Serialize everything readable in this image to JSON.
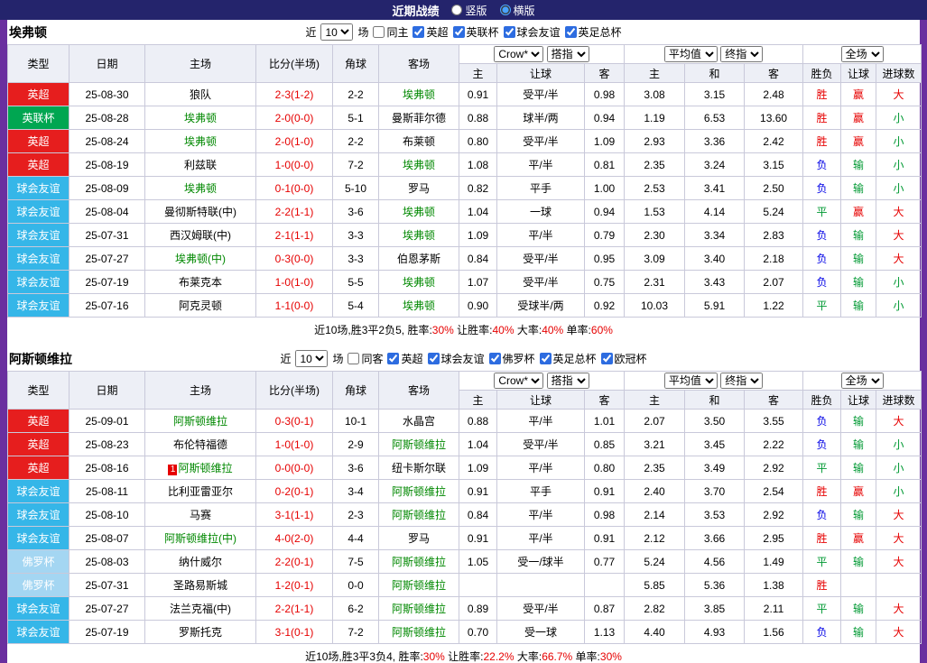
{
  "topbar": {
    "title": "近期战绩",
    "radios": [
      {
        "label": "竖版",
        "selected": false
      },
      {
        "label": "横版",
        "selected": true
      }
    ]
  },
  "columns": {
    "type": "类型",
    "date": "日期",
    "home": "主场",
    "score": "比分(半场)",
    "corner": "角球",
    "away": "客场",
    "odds_sel_a": "Crow*",
    "odds_sel_b": "搭指",
    "o1_home": "主",
    "o1_handicap": "让球",
    "o1_away": "客",
    "avg_sel_a": "平均值",
    "avg_sel_b": "终指",
    "o2_home": "主",
    "o2_draw": "和",
    "o2_away": "客",
    "full_sel": "全场",
    "r_result": "胜负",
    "r_handicap": "让球",
    "r_goals": "进球数"
  },
  "type_colors": {
    "英超": "#e61e1e",
    "英联杯": "#00a651",
    "球会友谊": "#35b6e8",
    "佛罗杯": "#a4d6f2"
  },
  "result_colors": {
    "red": "#e60000",
    "green": "#009933",
    "blue": "#0000e6"
  },
  "tables": [
    {
      "team": "埃弗顿",
      "filter": {
        "near": "近",
        "count": "10",
        "games": "场",
        "checks": [
          {
            "label": "同主",
            "checked": false
          },
          {
            "label": "英超",
            "checked": true
          },
          {
            "label": "英联杯",
            "checked": true
          },
          {
            "label": "球会友谊",
            "checked": true
          },
          {
            "label": "英足总杯",
            "checked": true
          }
        ]
      },
      "rows": [
        {
          "type": "英超",
          "date": "25-08-30",
          "home": {
            "name": "狼队",
            "hl": false
          },
          "score": "2-3(1-2)",
          "corner": "2-2",
          "away": {
            "name": "埃弗顿",
            "hl": true
          },
          "o1": [
            "0.91",
            "受平/半",
            "0.98"
          ],
          "o2": [
            "3.08",
            "3.15",
            "2.48"
          ],
          "res": {
            "t": "胜",
            "c": "red"
          },
          "let": {
            "t": "赢",
            "c": "red"
          },
          "goal": {
            "t": "大",
            "c": "red"
          }
        },
        {
          "type": "英联杯",
          "date": "25-08-28",
          "home": {
            "name": "埃弗顿",
            "hl": true
          },
          "score": "2-0(0-0)",
          "corner": "5-1",
          "away": {
            "name": "曼斯菲尔德",
            "hl": false
          },
          "o1": [
            "0.88",
            "球半/两",
            "0.94"
          ],
          "o2": [
            "1.19",
            "6.53",
            "13.60"
          ],
          "res": {
            "t": "胜",
            "c": "red"
          },
          "let": {
            "t": "赢",
            "c": "red"
          },
          "goal": {
            "t": "小",
            "c": "green"
          }
        },
        {
          "type": "英超",
          "date": "25-08-24",
          "home": {
            "name": "埃弗顿",
            "hl": true
          },
          "score": "2-0(1-0)",
          "corner": "2-2",
          "away": {
            "name": "布莱顿",
            "hl": false
          },
          "o1": [
            "0.80",
            "受平/半",
            "1.09"
          ],
          "o2": [
            "2.93",
            "3.36",
            "2.42"
          ],
          "res": {
            "t": "胜",
            "c": "red"
          },
          "let": {
            "t": "赢",
            "c": "red"
          },
          "goal": {
            "t": "小",
            "c": "green"
          }
        },
        {
          "type": "英超",
          "date": "25-08-19",
          "home": {
            "name": "利兹联",
            "hl": false
          },
          "score": "1-0(0-0)",
          "corner": "7-2",
          "away": {
            "name": "埃弗顿",
            "hl": true
          },
          "o1": [
            "1.08",
            "平/半",
            "0.81"
          ],
          "o2": [
            "2.35",
            "3.24",
            "3.15"
          ],
          "res": {
            "t": "负",
            "c": "blue"
          },
          "let": {
            "t": "输",
            "c": "green"
          },
          "goal": {
            "t": "小",
            "c": "green"
          }
        },
        {
          "type": "球会友谊",
          "date": "25-08-09",
          "home": {
            "name": "埃弗顿",
            "hl": true
          },
          "score": "0-1(0-0)",
          "corner": "5-10",
          "away": {
            "name": "罗马",
            "hl": false
          },
          "o1": [
            "0.82",
            "平手",
            "1.00"
          ],
          "o2": [
            "2.53",
            "3.41",
            "2.50"
          ],
          "res": {
            "t": "负",
            "c": "blue"
          },
          "let": {
            "t": "输",
            "c": "green"
          },
          "goal": {
            "t": "小",
            "c": "green"
          }
        },
        {
          "type": "球会友谊",
          "date": "25-08-04",
          "home": {
            "name": "曼彻斯特联(中)",
            "hl": false
          },
          "score": "2-2(1-1)",
          "corner": "3-6",
          "away": {
            "name": "埃弗顿",
            "hl": true
          },
          "o1": [
            "1.04",
            "一球",
            "0.94"
          ],
          "o2": [
            "1.53",
            "4.14",
            "5.24"
          ],
          "res": {
            "t": "平",
            "c": "green"
          },
          "let": {
            "t": "赢",
            "c": "red"
          },
          "goal": {
            "t": "大",
            "c": "red"
          }
        },
        {
          "type": "球会友谊",
          "date": "25-07-31",
          "home": {
            "name": "西汉姆联(中)",
            "hl": false
          },
          "score": "2-1(1-1)",
          "corner": "3-3",
          "away": {
            "name": "埃弗顿",
            "hl": true
          },
          "o1": [
            "1.09",
            "平/半",
            "0.79"
          ],
          "o2": [
            "2.30",
            "3.34",
            "2.83"
          ],
          "res": {
            "t": "负",
            "c": "blue"
          },
          "let": {
            "t": "输",
            "c": "green"
          },
          "goal": {
            "t": "大",
            "c": "red"
          }
        },
        {
          "type": "球会友谊",
          "date": "25-07-27",
          "home": {
            "name": "埃弗顿(中)",
            "hl": true
          },
          "score": "0-3(0-0)",
          "corner": "3-3",
          "away": {
            "name": "伯恩茅斯",
            "hl": false
          },
          "o1": [
            "0.84",
            "受平/半",
            "0.95"
          ],
          "o2": [
            "3.09",
            "3.40",
            "2.18"
          ],
          "res": {
            "t": "负",
            "c": "blue"
          },
          "let": {
            "t": "输",
            "c": "green"
          },
          "goal": {
            "t": "大",
            "c": "red"
          }
        },
        {
          "type": "球会友谊",
          "date": "25-07-19",
          "home": {
            "name": "布莱克本",
            "hl": false
          },
          "score": "1-0(1-0)",
          "corner": "5-5",
          "away": {
            "name": "埃弗顿",
            "hl": true
          },
          "o1": [
            "1.07",
            "受平/半",
            "0.75"
          ],
          "o2": [
            "2.31",
            "3.43",
            "2.07"
          ],
          "res": {
            "t": "负",
            "c": "blue"
          },
          "let": {
            "t": "输",
            "c": "green"
          },
          "goal": {
            "t": "小",
            "c": "green"
          }
        },
        {
          "type": "球会友谊",
          "date": "25-07-16",
          "home": {
            "name": "阿克灵顿",
            "hl": false
          },
          "score": "1-1(0-0)",
          "corner": "5-4",
          "away": {
            "name": "埃弗顿",
            "hl": true
          },
          "o1": [
            "0.90",
            "受球半/两",
            "0.92"
          ],
          "o2": [
            "10.03",
            "5.91",
            "1.22"
          ],
          "res": {
            "t": "平",
            "c": "green"
          },
          "let": {
            "t": "输",
            "c": "green"
          },
          "goal": {
            "t": "小",
            "c": "green"
          }
        }
      ],
      "summary": {
        "prefix": "近10场,胜3平2负5, ",
        "items": [
          {
            "label": "胜率:",
            "value": "30%"
          },
          {
            "label": "让胜率:",
            "value": "40%"
          },
          {
            "label": "大率:",
            "value": "40%"
          },
          {
            "label": "单率:",
            "value": "60%"
          }
        ]
      }
    },
    {
      "team": "阿斯顿维拉",
      "filter": {
        "near": "近",
        "count": "10",
        "games": "场",
        "checks": [
          {
            "label": "同客",
            "checked": false
          },
          {
            "label": "英超",
            "checked": true
          },
          {
            "label": "球会友谊",
            "checked": true
          },
          {
            "label": "佛罗杯",
            "checked": true
          },
          {
            "label": "英足总杯",
            "checked": true
          },
          {
            "label": "欧冠杯",
            "checked": true
          }
        ]
      },
      "rows": [
        {
          "type": "英超",
          "date": "25-09-01",
          "home": {
            "name": "阿斯顿维拉",
            "hl": true
          },
          "score": "0-3(0-1)",
          "corner": "10-1",
          "away": {
            "name": "水晶宫",
            "hl": false
          },
          "o1": [
            "0.88",
            "平/半",
            "1.01"
          ],
          "o2": [
            "2.07",
            "3.50",
            "3.55"
          ],
          "res": {
            "t": "负",
            "c": "blue"
          },
          "let": {
            "t": "输",
            "c": "green"
          },
          "goal": {
            "t": "大",
            "c": "red"
          }
        },
        {
          "type": "英超",
          "date": "25-08-23",
          "home": {
            "name": "布伦特福德",
            "hl": false
          },
          "score": "1-0(1-0)",
          "corner": "2-9",
          "away": {
            "name": "阿斯顿维拉",
            "hl": true
          },
          "o1": [
            "1.04",
            "受平/半",
            "0.85"
          ],
          "o2": [
            "3.21",
            "3.45",
            "2.22"
          ],
          "res": {
            "t": "负",
            "c": "blue"
          },
          "let": {
            "t": "输",
            "c": "green"
          },
          "goal": {
            "t": "小",
            "c": "green"
          }
        },
        {
          "type": "英超",
          "date": "25-08-16",
          "home": {
            "name": "阿斯顿维拉",
            "hl": true,
            "badge": "1"
          },
          "score": "0-0(0-0)",
          "corner": "3-6",
          "away": {
            "name": "纽卡斯尔联",
            "hl": false
          },
          "o1": [
            "1.09",
            "平/半",
            "0.80"
          ],
          "o2": [
            "2.35",
            "3.49",
            "2.92"
          ],
          "res": {
            "t": "平",
            "c": "green"
          },
          "let": {
            "t": "输",
            "c": "green"
          },
          "goal": {
            "t": "小",
            "c": "green"
          }
        },
        {
          "type": "球会友谊",
          "date": "25-08-11",
          "home": {
            "name": "比利亚雷亚尔",
            "hl": false
          },
          "score": "0-2(0-1)",
          "corner": "3-4",
          "away": {
            "name": "阿斯顿维拉",
            "hl": true
          },
          "o1": [
            "0.91",
            "平手",
            "0.91"
          ],
          "o2": [
            "2.40",
            "3.70",
            "2.54"
          ],
          "res": {
            "t": "胜",
            "c": "red"
          },
          "let": {
            "t": "赢",
            "c": "red"
          },
          "goal": {
            "t": "小",
            "c": "green"
          }
        },
        {
          "type": "球会友谊",
          "date": "25-08-10",
          "home": {
            "name": "马赛",
            "hl": false
          },
          "score": "3-1(1-1)",
          "corner": "2-3",
          "away": {
            "name": "阿斯顿维拉",
            "hl": true
          },
          "o1": [
            "0.84",
            "平/半",
            "0.98"
          ],
          "o2": [
            "2.14",
            "3.53",
            "2.92"
          ],
          "res": {
            "t": "负",
            "c": "blue"
          },
          "let": {
            "t": "输",
            "c": "green"
          },
          "goal": {
            "t": "大",
            "c": "red"
          }
        },
        {
          "type": "球会友谊",
          "date": "25-08-07",
          "home": {
            "name": "阿斯顿维拉(中)",
            "hl": true
          },
          "score": "4-0(2-0)",
          "corner": "4-4",
          "away": {
            "name": "罗马",
            "hl": false
          },
          "o1": [
            "0.91",
            "平/半",
            "0.91"
          ],
          "o2": [
            "2.12",
            "3.66",
            "2.95"
          ],
          "res": {
            "t": "胜",
            "c": "red"
          },
          "let": {
            "t": "赢",
            "c": "red"
          },
          "goal": {
            "t": "大",
            "c": "red"
          }
        },
        {
          "type": "佛罗杯",
          "date": "25-08-03",
          "home": {
            "name": "纳什威尔",
            "hl": false
          },
          "score": "2-2(0-1)",
          "corner": "7-5",
          "away": {
            "name": "阿斯顿维拉",
            "hl": true
          },
          "o1": [
            "1.05",
            "受一/球半",
            "0.77"
          ],
          "o2": [
            "5.24",
            "4.56",
            "1.49"
          ],
          "res": {
            "t": "平",
            "c": "green"
          },
          "let": {
            "t": "输",
            "c": "green"
          },
          "goal": {
            "t": "大",
            "c": "red"
          }
        },
        {
          "type": "佛罗杯",
          "date": "25-07-31",
          "home": {
            "name": "圣路易斯城",
            "hl": false
          },
          "score": "1-2(0-1)",
          "corner": "0-0",
          "away": {
            "name": "阿斯顿维拉",
            "hl": true
          },
          "o1": [
            "",
            "",
            ""
          ],
          "o2": [
            "5.85",
            "5.36",
            "1.38"
          ],
          "res": {
            "t": "胜",
            "c": "red"
          },
          "let": {
            "t": "",
            "c": ""
          },
          "goal": {
            "t": "",
            "c": ""
          }
        },
        {
          "type": "球会友谊",
          "date": "25-07-27",
          "home": {
            "name": "法兰克福(中)",
            "hl": false
          },
          "score": "2-2(1-1)",
          "corner": "6-2",
          "away": {
            "name": "阿斯顿维拉",
            "hl": true
          },
          "o1": [
            "0.89",
            "受平/半",
            "0.87"
          ],
          "o2": [
            "2.82",
            "3.85",
            "2.11"
          ],
          "res": {
            "t": "平",
            "c": "green"
          },
          "let": {
            "t": "输",
            "c": "green"
          },
          "goal": {
            "t": "大",
            "c": "red"
          }
        },
        {
          "type": "球会友谊",
          "date": "25-07-19",
          "home": {
            "name": "罗斯托克",
            "hl": false
          },
          "score": "3-1(0-1)",
          "corner": "7-2",
          "away": {
            "name": "阿斯顿维拉",
            "hl": true
          },
          "o1": [
            "0.70",
            "受一球",
            "1.13"
          ],
          "o2": [
            "4.40",
            "4.93",
            "1.56"
          ],
          "res": {
            "t": "负",
            "c": "blue"
          },
          "let": {
            "t": "输",
            "c": "green"
          },
          "goal": {
            "t": "大",
            "c": "red"
          }
        }
      ],
      "summary": {
        "prefix": "近10场,胜3平3负4, ",
        "items": [
          {
            "label": "胜率:",
            "value": "30%"
          },
          {
            "label": "让胜率:",
            "value": "22.2%"
          },
          {
            "label": "大率:",
            "value": "66.7%"
          },
          {
            "label": "单率:",
            "value": "30%"
          }
        ]
      }
    }
  ]
}
